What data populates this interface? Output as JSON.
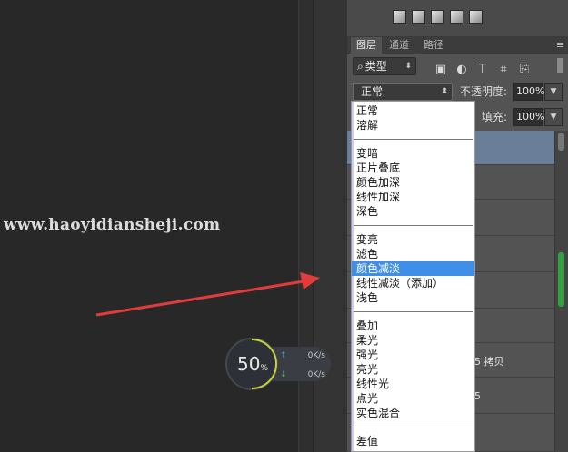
{
  "canvas": {
    "watermark": "www.haoyidiansheji.com"
  },
  "net_widget": {
    "percent": "50",
    "percent_unit": "%",
    "upload": "0K/s",
    "download": "0K/s",
    "upload_icon": "arrow-up",
    "download_icon": "arrow-down",
    "arc_color": "#c8d23c",
    "progress": 0.5
  },
  "panel": {
    "tabs": [
      "图层",
      "通道",
      "路径"
    ],
    "menu_icon": "≡",
    "filter": {
      "label": "类型",
      "search_icon": "⌕",
      "icons": [
        "image-filter-icon",
        "adjustment-filter-icon",
        "text-filter-icon",
        "shape-filter-icon",
        "smart-object-filter-icon"
      ],
      "icon_glyphs": [
        "▣",
        "◐",
        "T",
        "⌗",
        "⎘"
      ]
    },
    "blend_mode": "正常",
    "opacity_label": "不透明度:",
    "opacity_value": "100%",
    "fill_label": "填充:",
    "fill_value": "100%",
    "layers_partial": [
      "5 拷贝",
      "5"
    ]
  },
  "blend_menu": {
    "groups": [
      [
        "正常",
        "溶解"
      ],
      [
        "变暗",
        "正片叠底",
        "颜色加深",
        "线性加深",
        "深色"
      ],
      [
        "变亮",
        "滤色",
        "颜色减淡",
        "线性减淡（添加）",
        "浅色"
      ],
      [
        "叠加",
        "柔光",
        "强光",
        "亮光",
        "线性光",
        "点光",
        "实色混合"
      ],
      [
        "差值"
      ]
    ],
    "highlighted": "颜色减淡",
    "highlight_color": "#3f8ee8"
  },
  "colors": {
    "arrow": "#e03c3c",
    "selected_layer": "#6b7e99",
    "scroll_thumb": "#35a041"
  }
}
